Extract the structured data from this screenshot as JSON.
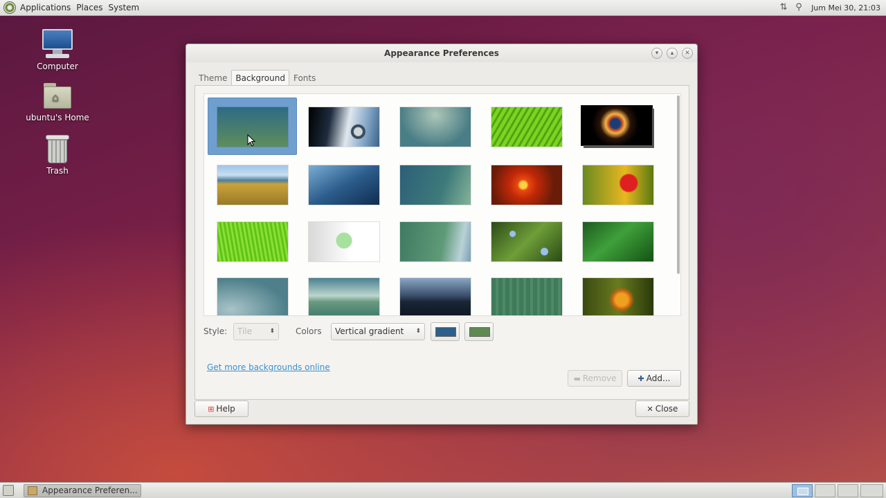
{
  "top_panel": {
    "menus": [
      "Applications",
      "Places",
      "System"
    ],
    "clock": "Jum Mei 30, 21:03",
    "tray_icons": [
      "network-icon",
      "search-icon"
    ]
  },
  "desktop": {
    "icons": [
      {
        "label": "Computer",
        "icon": "computer-icon"
      },
      {
        "label": "ubuntu's Home",
        "icon": "home-folder-icon"
      },
      {
        "label": "Trash",
        "icon": "trash-icon"
      }
    ]
  },
  "dialog": {
    "title": "Appearance Preferences",
    "tabs": [
      "Theme",
      "Background",
      "Fonts"
    ],
    "active_tab": "Background",
    "style_label": "Style:",
    "style_value": "Tile",
    "colors_label": "Colors",
    "colors_value": "Vertical gradient",
    "primary_color": "#2e5f8a",
    "secondary_color": "#5e8a52",
    "link_text": "Get more backgrounds online",
    "remove_label": "Remove",
    "add_label": "Add...",
    "help_label": "Help",
    "close_label": "Close"
  },
  "taskbar": {
    "task_label": "Appearance Preferen..."
  }
}
